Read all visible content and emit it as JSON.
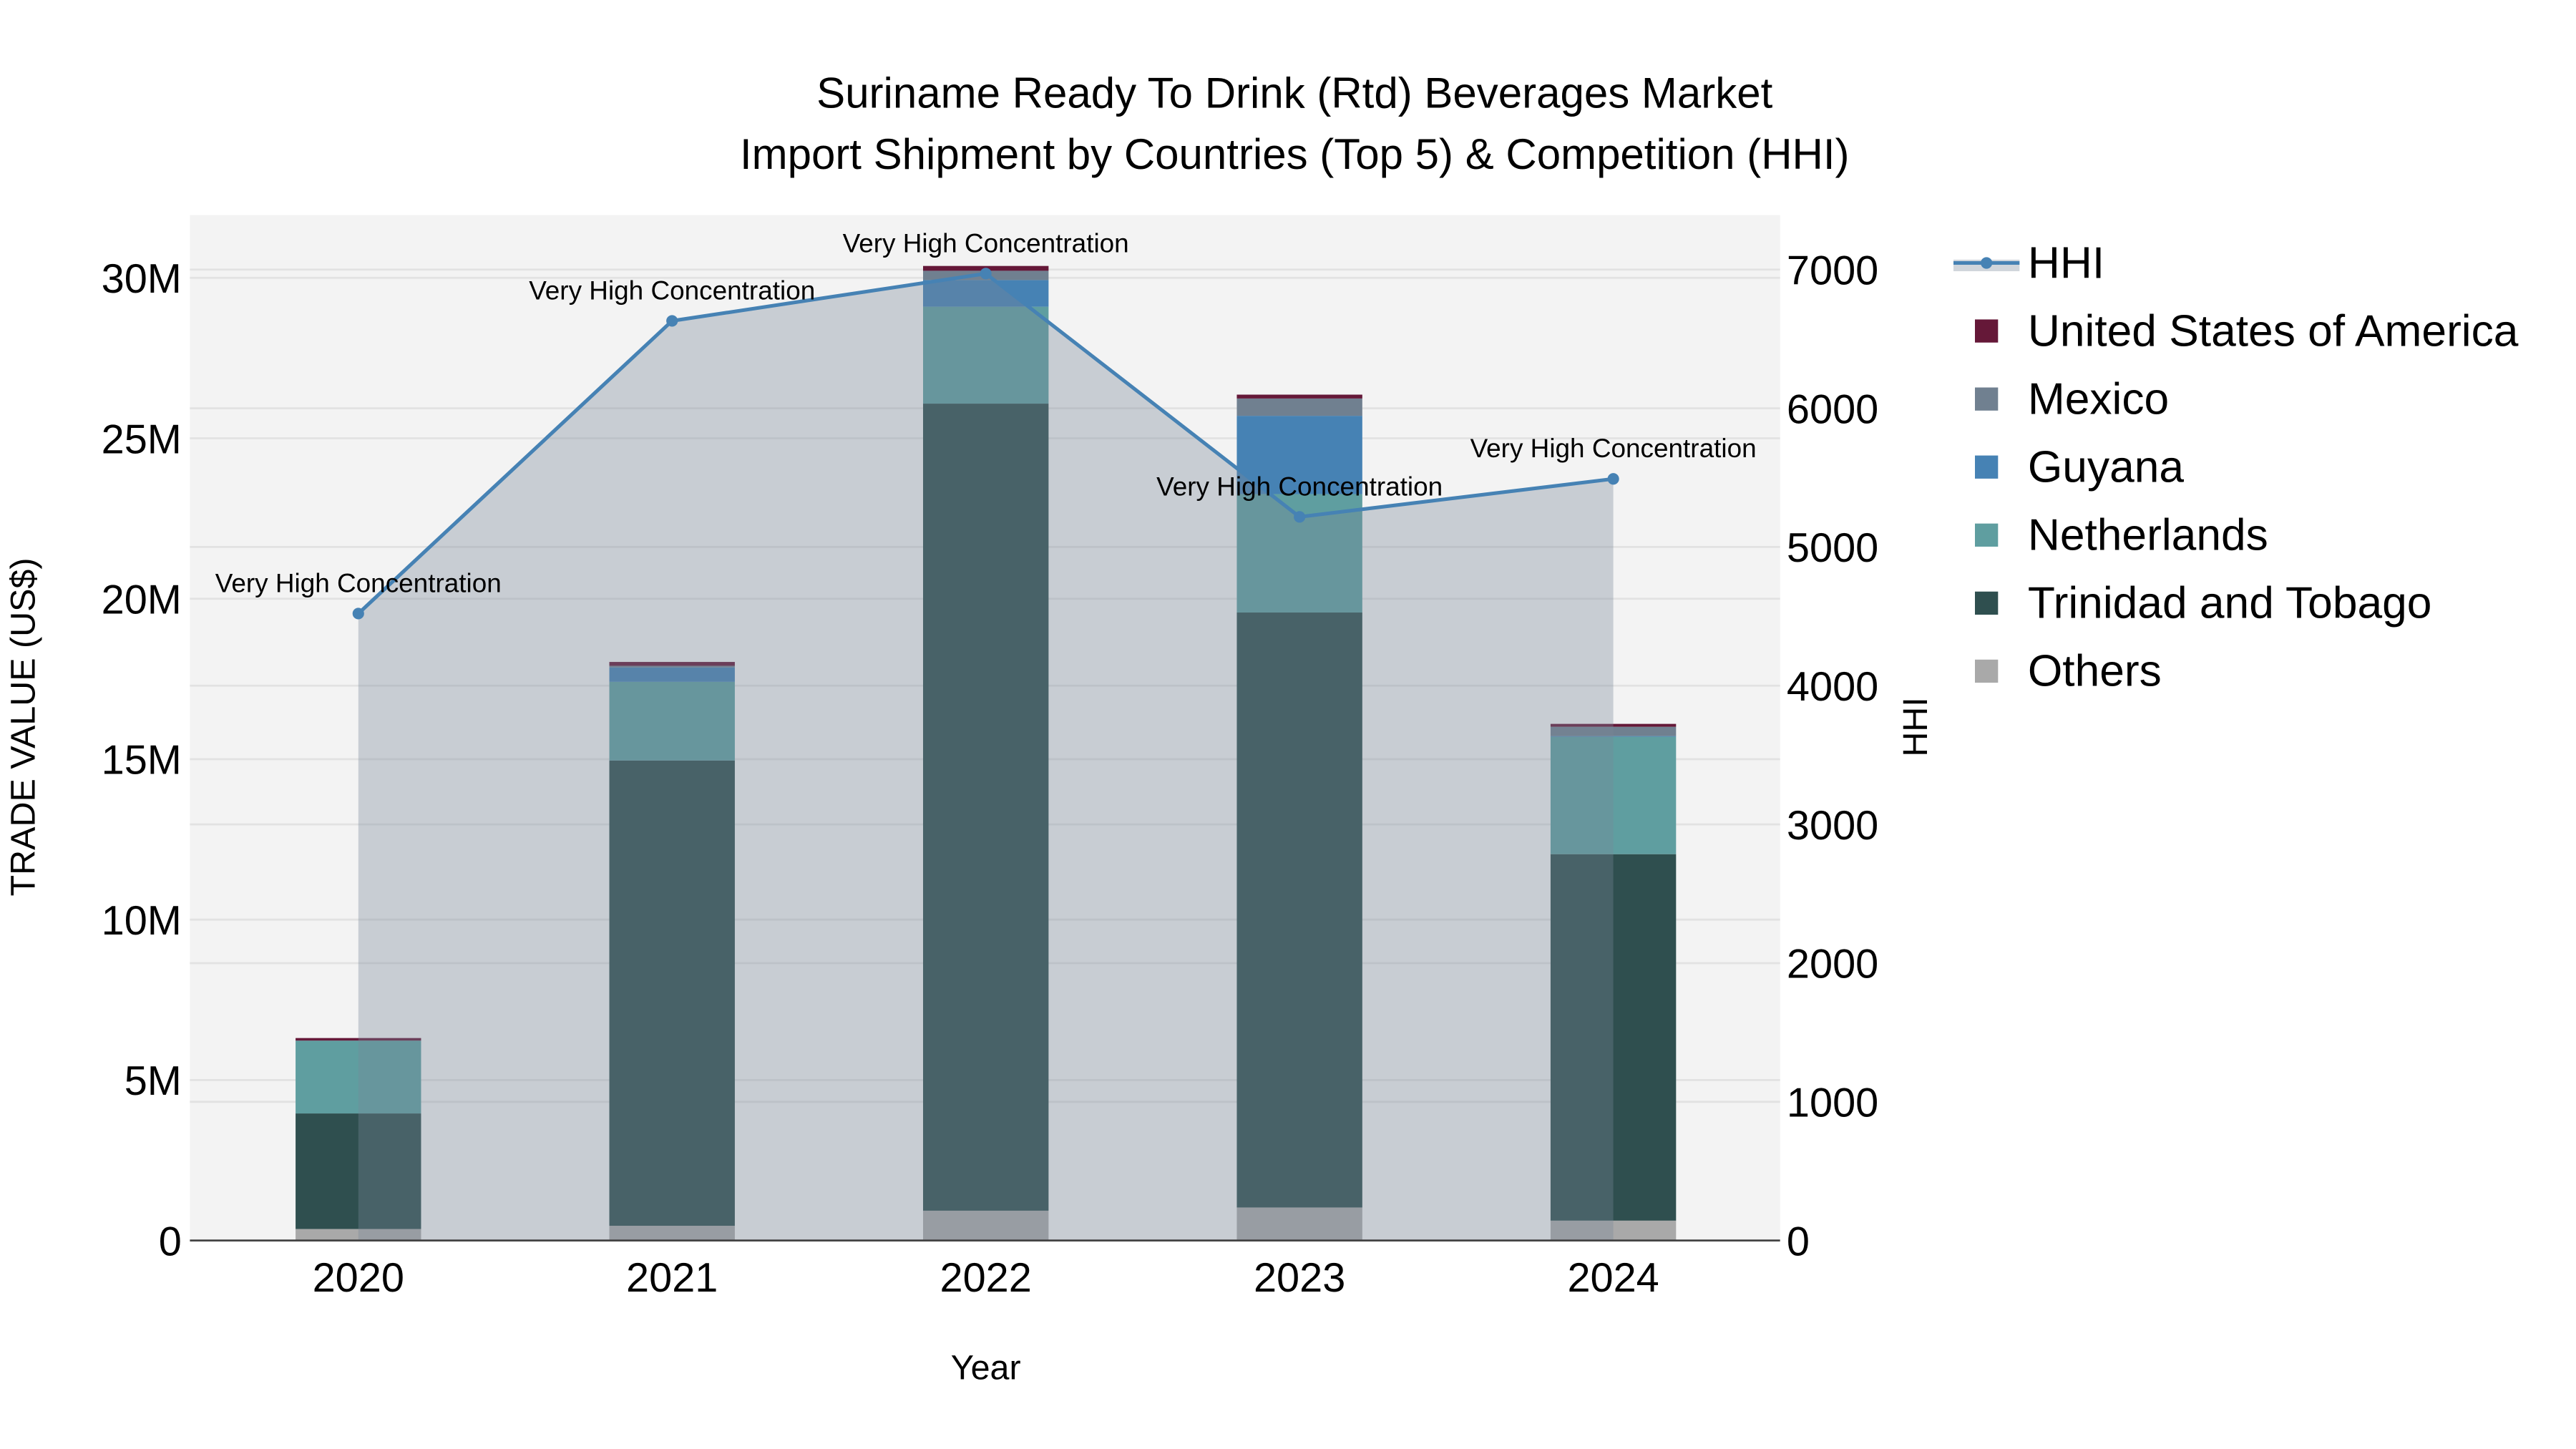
{
  "chart_data": {
    "type": "bar",
    "title": [
      "Suriname Ready To Drink (Rtd) Beverages Market",
      "Import Shipment by Countries (Top 5) & Competition (HHI)"
    ],
    "xlabel": "Year",
    "ylabel": "TRADE VALUE (US$)",
    "y2label": "HHI",
    "categories": [
      "2020",
      "2021",
      "2022",
      "2023",
      "2024"
    ],
    "stacked": true,
    "ylim": [
      0,
      32000000
    ],
    "y2lim": [
      0,
      7400
    ],
    "yticks": [
      0,
      5000000,
      10000000,
      15000000,
      20000000,
      25000000,
      30000000
    ],
    "ytick_labels": [
      "0",
      "5M",
      "10M",
      "15M",
      "20M",
      "25M",
      "30M"
    ],
    "y2ticks": [
      0,
      1000,
      2000,
      3000,
      4000,
      5000,
      6000,
      7000
    ],
    "y2tick_labels": [
      "0",
      "1000",
      "2000",
      "3000",
      "4000",
      "5000",
      "6000",
      "7000"
    ],
    "grid": true,
    "legend_placement": "right",
    "series": [
      {
        "name": "Others",
        "color": "#a9a9a9",
        "values": [
          360000,
          460000,
          930000,
          1030000,
          620000
        ]
      },
      {
        "name": "Trinidad and Tobago",
        "color": "#2f4f4f",
        "values": [
          3600000,
          14500000,
          25150000,
          18540000,
          11420000
        ]
      },
      {
        "name": "Netherlands",
        "color": "#5f9ea0",
        "values": [
          2270000,
          2450000,
          3020000,
          3690000,
          3660000
        ]
      },
      {
        "name": "Guyana",
        "color": "#4682b4",
        "values": [
          0,
          450000,
          830000,
          2440000,
          20000
        ]
      },
      {
        "name": "Mexico",
        "color": "#708090",
        "values": [
          0,
          50000,
          290000,
          540000,
          290000
        ]
      },
      {
        "name": "United States of America",
        "color": "#651838",
        "values": [
          80000,
          120000,
          150000,
          120000,
          90000
        ]
      }
    ],
    "hhi": {
      "name": "HHI",
      "color": "#4682b4",
      "area_color": "#778899",
      "values": [
        4520,
        6630,
        6971,
        5217,
        5491
      ],
      "annotations": [
        "Very High Concentration",
        "Very High Concentration",
        "Very High Concentration",
        "Very High Concentration",
        "Very High Concentration"
      ]
    },
    "legend_order": [
      "HHI",
      "United States of America",
      "Mexico",
      "Guyana",
      "Netherlands",
      "Trinidad and Tobago",
      "Others"
    ]
  }
}
